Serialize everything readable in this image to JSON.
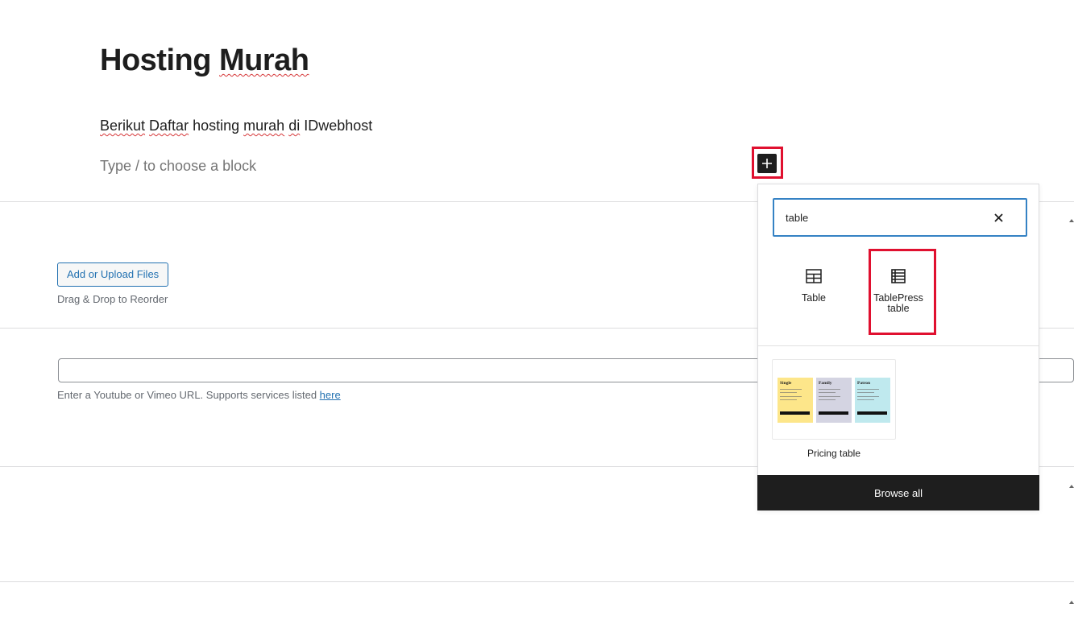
{
  "post": {
    "title_part1": "Hosting",
    "title_part2": "Murah",
    "paragraph": {
      "w1": "Berikut",
      "w2": "Daftar",
      "w3": "hosting",
      "w4": "murah",
      "w5": "di",
      "w6": "IDwebhost"
    },
    "block_placeholder": "Type / to choose a block"
  },
  "gallery": {
    "upload_button": "Add or Upload Files",
    "drag_hint": "Drag & Drop to Reorder"
  },
  "video": {
    "help_text": "Enter a Youtube or Vimeo URL. Supports services listed ",
    "help_link": "here"
  },
  "inserter": {
    "search_value": "table",
    "blocks": [
      {
        "label": "Table",
        "icon": "table-icon"
      },
      {
        "label_line1": "TablePress",
        "label_line2": "table",
        "icon": "tablepress-icon"
      }
    ],
    "patterns": [
      {
        "label": "Pricing table",
        "columns": [
          {
            "title": "Single",
            "color": "#fde68a"
          },
          {
            "title": "Family",
            "color": "#d4d4e2"
          },
          {
            "title": "Patron",
            "color": "#bfe9ee"
          }
        ]
      }
    ],
    "browse_all": "Browse all"
  },
  "colors": {
    "highlight": "#e0102f",
    "accent": "#3582c4",
    "link": "#2271b1",
    "dark": "#1e1e1e"
  }
}
